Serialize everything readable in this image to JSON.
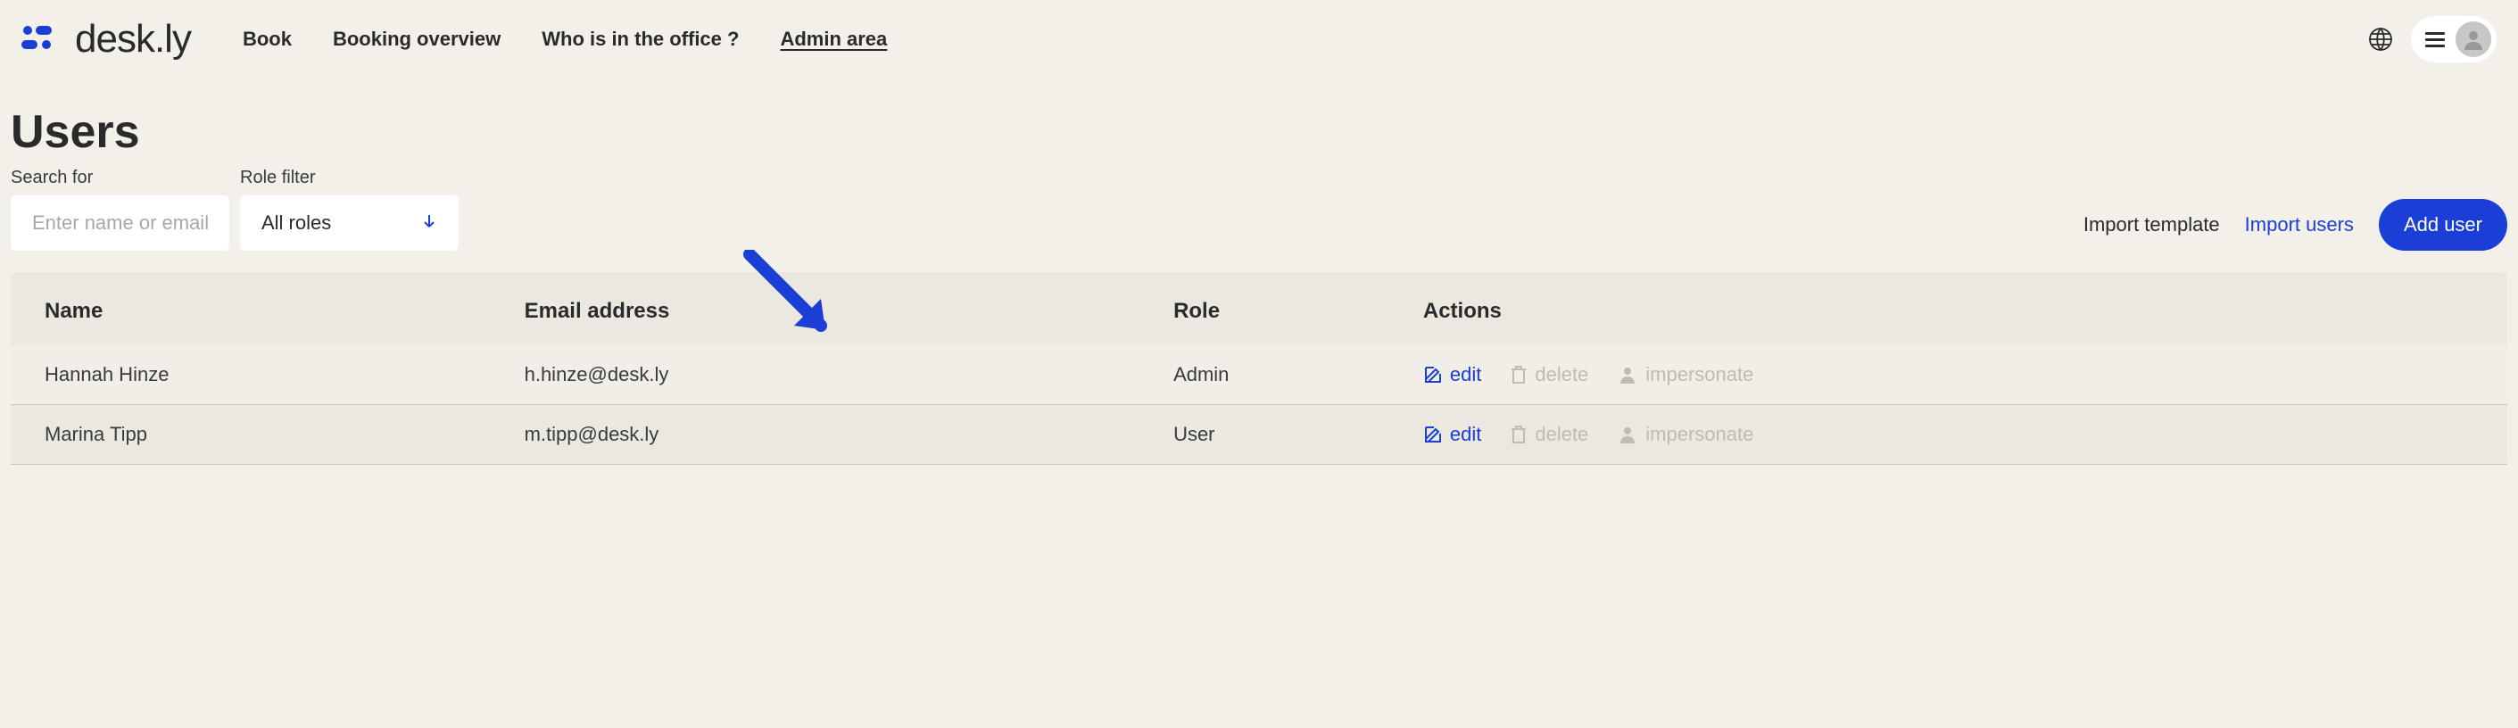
{
  "brand": {
    "name": "desk.ly"
  },
  "nav": {
    "items": [
      {
        "label": "Book",
        "active": false
      },
      {
        "label": "Booking overview",
        "active": false
      },
      {
        "label": "Who is in the office ?",
        "active": false
      },
      {
        "label": "Admin area",
        "active": true
      }
    ]
  },
  "page": {
    "title": "Users"
  },
  "filters": {
    "search_label": "Search for",
    "search_placeholder": "Enter name or email addre",
    "role_label": "Role filter",
    "role_selected": "All roles"
  },
  "actions_bar": {
    "import_template": "Import template",
    "import_users": "Import users",
    "add_user": "Add user"
  },
  "table": {
    "headers": {
      "name": "Name",
      "email": "Email address",
      "role": "Role",
      "actions": "Actions"
    },
    "row_actions": {
      "edit": "edit",
      "delete": "delete",
      "impersonate": "impersonate"
    },
    "rows": [
      {
        "name": "Hannah Hinze",
        "email": "h.hinze@desk.ly",
        "role": "Admin"
      },
      {
        "name": "Marina Tipp",
        "email": "m.tipp@desk.ly",
        "role": "User"
      }
    ]
  }
}
